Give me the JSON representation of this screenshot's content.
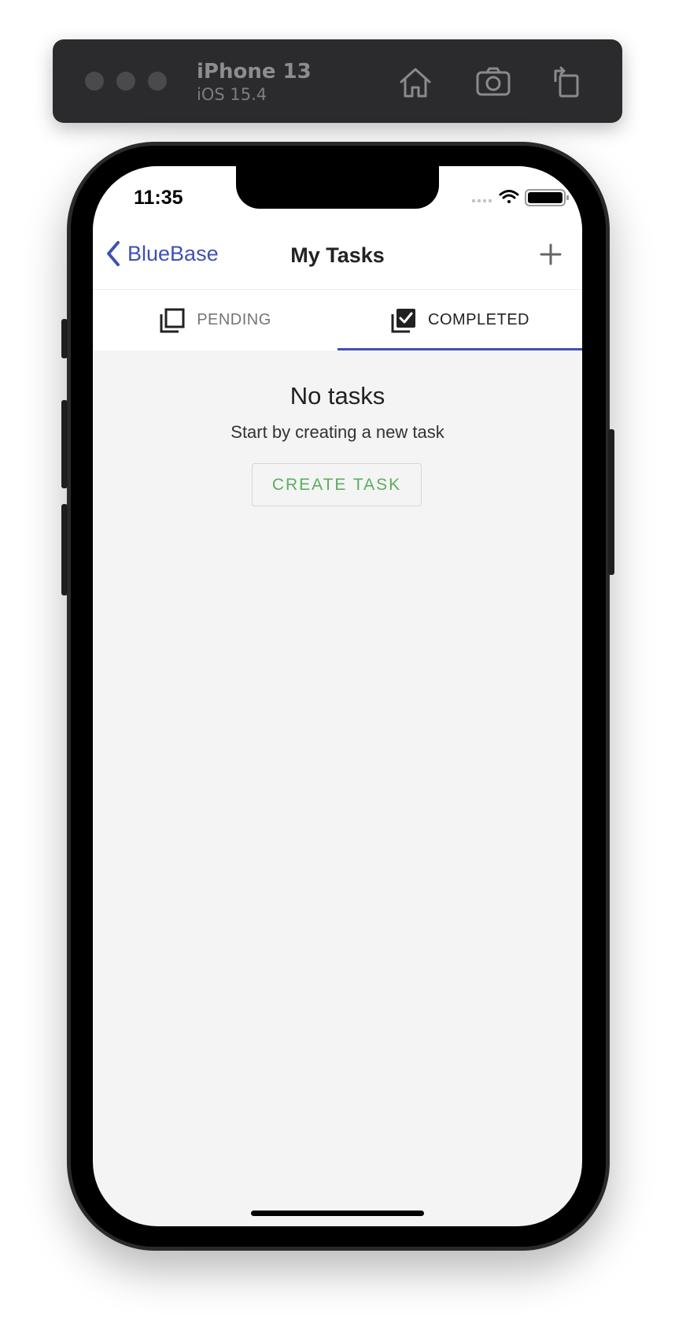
{
  "simulator": {
    "device_name": "iPhone 13",
    "os_version": "iOS 15.4",
    "toolbar_icons": [
      "home-icon",
      "camera-icon",
      "rotate-icon"
    ]
  },
  "status_bar": {
    "time": "11:35",
    "icons": [
      "signal-icon",
      "wifi-icon",
      "battery-icon"
    ]
  },
  "nav": {
    "back_label": "BlueBase",
    "title": "My Tasks",
    "add_icon": "plus-icon"
  },
  "tabs": [
    {
      "label": "PENDING",
      "icon": "pending-tab-icon",
      "selected": false
    },
    {
      "label": "COMPLETED",
      "icon": "completed-tab-icon",
      "selected": true
    }
  ],
  "empty_state": {
    "title": "No tasks",
    "subtitle": "Start by creating a new task",
    "button_label": "CREATE TASK"
  },
  "colors": {
    "accent": "#3f51b5",
    "button_text": "#5cad5f",
    "background": "#f4f4f4"
  }
}
